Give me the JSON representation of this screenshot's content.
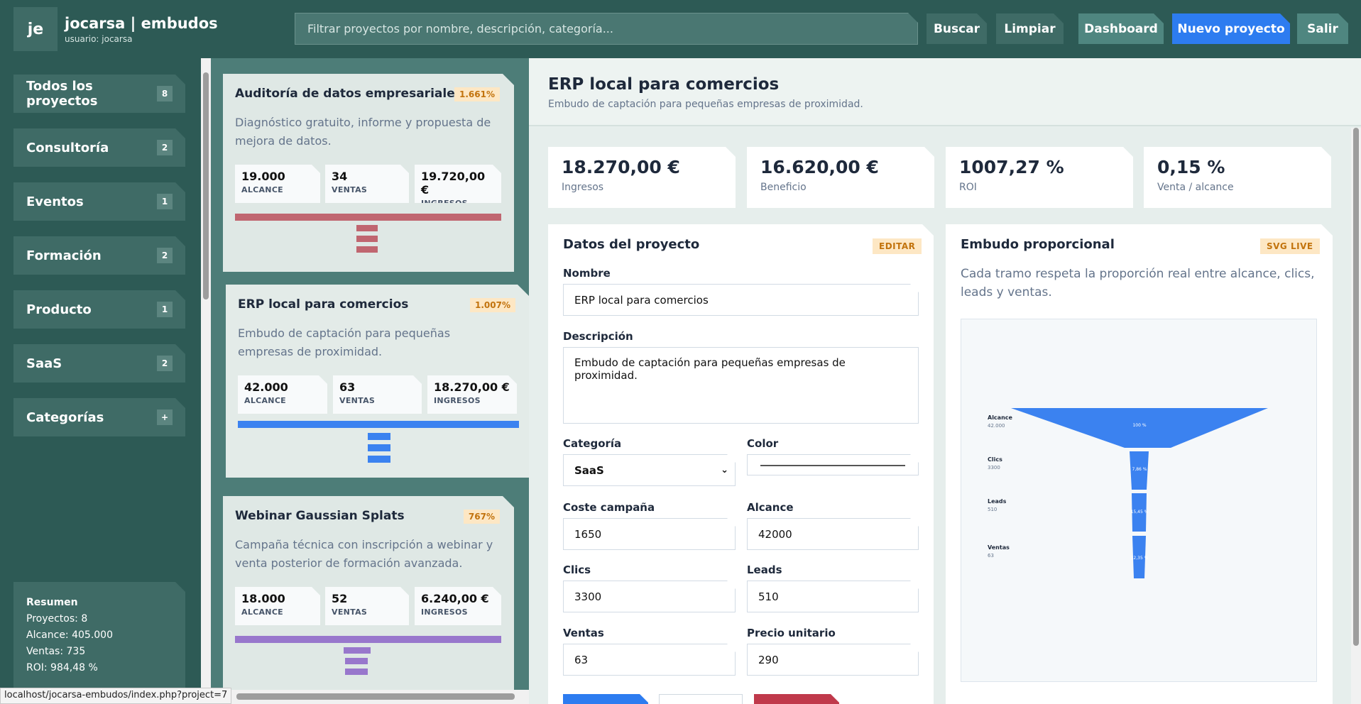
{
  "header": {
    "logo_text": "je",
    "brand_title": "jocarsa | embudos",
    "user_label": "usuario: jocarsa",
    "search_placeholder": "Filtrar proyectos por nombre, descripción, categoría...",
    "buttons": {
      "search": "Buscar",
      "clear": "Limpiar",
      "dashboard": "Dashboard",
      "new_project": "Nuevo proyecto",
      "logout": "Salir"
    }
  },
  "sidebar": {
    "items": [
      {
        "label": "Todos los proyectos",
        "count": "8"
      },
      {
        "label": "Consultoría",
        "count": "2"
      },
      {
        "label": "Eventos",
        "count": "1"
      },
      {
        "label": "Formación",
        "count": "2"
      },
      {
        "label": "Producto",
        "count": "1"
      },
      {
        "label": "SaaS",
        "count": "2"
      },
      {
        "label": "Categorías",
        "count": "+"
      }
    ],
    "summary": {
      "title": "Resumen",
      "projects": "Proyectos: 8",
      "reach": "Alcance: 405.000",
      "sales": "Ventas: 735",
      "roi": "ROI: 984,48 %"
    }
  },
  "projects": [
    {
      "title": "Auditoría de datos empresariales",
      "roi": "1.661%",
      "description": "Diagnóstico gratuito, informe y propuesta de mejora de datos.",
      "reach": "19.000",
      "sales": "34",
      "revenue": "19.720,00 €",
      "color": "#c06670"
    },
    {
      "title": "ERP local para comercios",
      "roi": "1.007%",
      "description": "Embudo de captación para pequeñas empresas de proximidad.",
      "reach": "42.000",
      "sales": "63",
      "revenue": "18.270,00 €",
      "color": "#3b82f0"
    },
    {
      "title": "Webinar Gaussian Splats",
      "roi": "767%",
      "description": "Campaña técnica con inscripción a webinar y venta posterior de formación avanzada.",
      "reach": "18.000",
      "sales": "52",
      "revenue": "6.240,00 €",
      "color": "#9877cc"
    }
  ],
  "stat_labels": {
    "reach": "ALCANCE",
    "sales": "VENTAS",
    "revenue": "INGRESOS"
  },
  "detail": {
    "title": "ERP local para comercios",
    "subtitle": "Embudo de captación para pequeñas empresas de proximidad.",
    "kpis": [
      {
        "value": "18.270,00 €",
        "label": "Ingresos"
      },
      {
        "value": "16.620,00 €",
        "label": "Beneficio"
      },
      {
        "value": "1007,27 %",
        "label": "ROI"
      },
      {
        "value": "0,15 %",
        "label": "Venta / alcance"
      }
    ],
    "form": {
      "title": "Datos del proyecto",
      "tag": "EDITAR",
      "name_label": "Nombre",
      "name_value": "ERP local para comercios",
      "description_label": "Descripción",
      "description_value": "Embudo de captación para pequeñas empresas de proximidad.",
      "category_label": "Categoría",
      "category_value": "SaaS",
      "color_label": "Color",
      "cost_label": "Coste campaña",
      "cost_value": "1650",
      "reach_label": "Alcance",
      "reach_value": "42000",
      "clicks_label": "Clics",
      "clicks_value": "3300",
      "leads_label": "Leads",
      "leads_value": "510",
      "sales_label": "Ventas",
      "sales_value": "63",
      "price_label": "Precio unitario",
      "price_value": "290"
    },
    "funnel": {
      "title": "Embudo proporcional",
      "tag": "SVG LIVE",
      "description": "Cada tramo respeta la proporción real entre alcance, clics, leads y ventas.",
      "stages": [
        {
          "name": "Alcance",
          "value": "42.000",
          "pct": "100 %",
          "ratio": 1.0
        },
        {
          "name": "Clics",
          "value": "3300",
          "pct": "7,86 %",
          "ratio": 0.0786
        },
        {
          "name": "Leads",
          "value": "510",
          "pct": "15,45 %",
          "ratio": 0.0121
        },
        {
          "name": "Ventas",
          "value": "63",
          "pct": "12,35 %",
          "ratio": 0.0015
        }
      ],
      "color": "#3b82f0"
    }
  },
  "status_url": "localhost/jocarsa-embudos/index.php?project=7"
}
